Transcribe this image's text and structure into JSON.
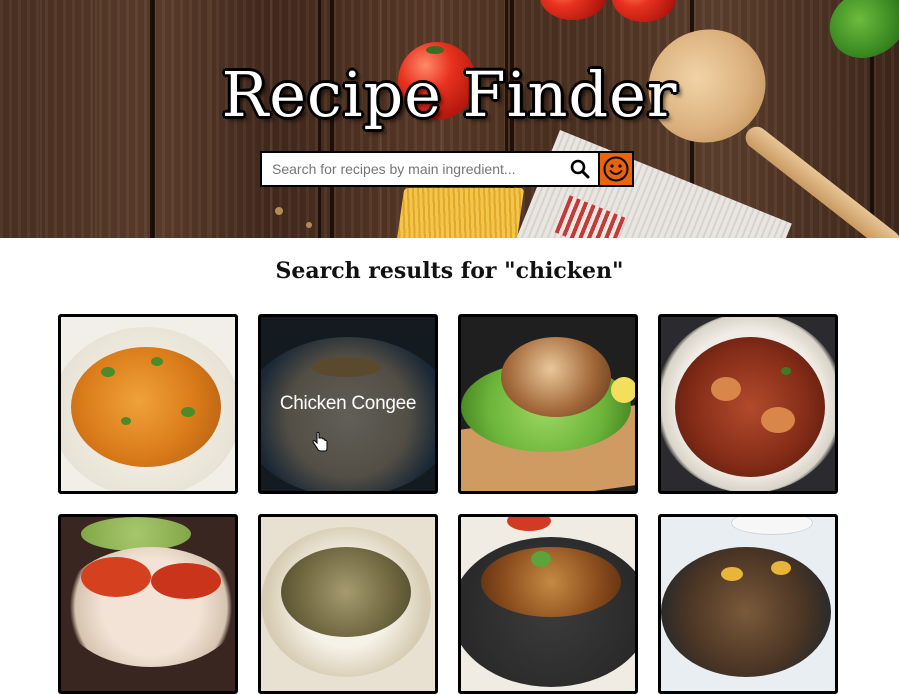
{
  "header": {
    "title": "Recipe Finder",
    "search_placeholder": "Search for recipes by main ingredient...",
    "search_icon": "search-icon",
    "random_icon": "smiley-icon",
    "accent_color": "#e8650e"
  },
  "results": {
    "heading": "Search results for \"chicken\"",
    "cards": [
      {
        "image": "chicken-curry-plate",
        "label": ""
      },
      {
        "image": "chicken-congee-bowl",
        "label": "Chicken Congee",
        "hovered": true
      },
      {
        "image": "grilled-chicken-lettuce-board",
        "label": ""
      },
      {
        "image": "braised-chicken-pot",
        "label": ""
      },
      {
        "image": "chicken-tomato-dish",
        "label": ""
      },
      {
        "image": "chicken-rice-plate",
        "label": ""
      },
      {
        "image": "chicken-salad-bowl",
        "label": ""
      },
      {
        "image": "chicken-stew-pan",
        "label": ""
      }
    ]
  }
}
